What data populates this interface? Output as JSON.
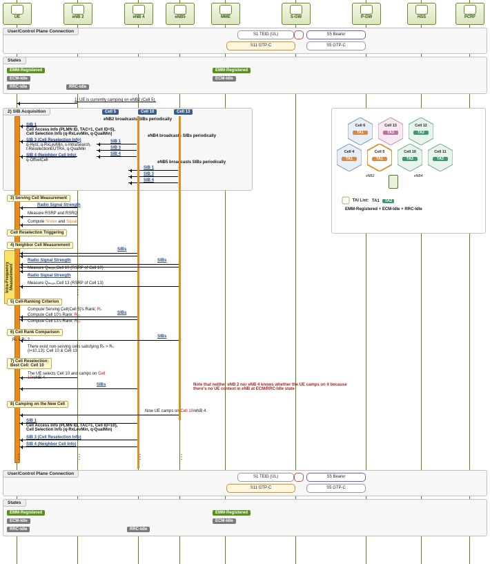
{
  "nodes": {
    "ue": "UE",
    "enb2": "eNB 2",
    "enb4": "eNB 4",
    "enb5": "eNB5",
    "mme": "MME",
    "sgw": "S-GW",
    "pgw": "P-GW",
    "hss": "HSS",
    "pcrf": "PCRF"
  },
  "conn_title": "User/Control Plane Connection",
  "conn": {
    "s1": "S1 TEID (UL)",
    "s5": "S5 Bearer",
    "s11": "S11 GTP-C",
    "s5g": "S5 GTP-C"
  },
  "states_title": "States",
  "states": {
    "emm": "EMM-Registered",
    "ecm": "ECM-Idle",
    "rrc": "RRC-Idle"
  },
  "step1": "1) UE is currently camping on eNB2 (Cell 5).",
  "sib_title": "2) SIB Acquisition",
  "cells": {
    "c5": "Cell 5",
    "c10": "Cell 10",
    "c13": "Cell 13"
  },
  "bcast": {
    "e2": "eNB2 broadcasts SIBs periodically",
    "e4": "eNB4 broadcasts SIBs periodically",
    "e5": "eNB5 broadcasts SIBs periodically"
  },
  "sibnames": {
    "s1": "SIB 1",
    "s3": "SIB 3",
    "s4": "SIB 4",
    "short3": "SIB 3 (Cell Reselection Info)",
    "short4": "SIB 4 (Neighbor Cell Info)",
    "sibs": "SIBs"
  },
  "sib1_line": "Cell Access Info (PLMN ID, TAC=1, Cell ID=5),\nCell Selection Info (q-RxLevMin, q-QualMin)",
  "sib3_line": "q-Hyst, q-RxLevMin, s-IntraSearch,\nt-ReselectionEUTRA, q-QualMin",
  "sib4_line": "q-OffsetCell",
  "step3": "3) Serving Cell Measurement",
  "rss": "Radio Signal Strength",
  "m1": "Measure RSRP and RSRQ",
  "m2": "Compute Srxlev and Squal",
  "crt": "Cell Reselection Triggering",
  "step4": "4) Neighbor Cell Measurement",
  "vstrip": "Intra-Frequency\nMeasurement",
  "q10": "Measure Qₘₑₐₛ,Cell 10 (RSRP of Cell 10)",
  "q13": "Measure Qₘₑₐₛ,Cell 13 (RSRP of Cell 13)",
  "step5": "5) Cell-Ranking Criterion",
  "rank_s": "Compute Serving Cell(Cell 5)'s Rank:",
  "rank_10": "Compute Cell 10's Rank:",
  "rank_13": "Compute Cell 13's Rank:",
  "Rs": "Rₛ",
  "R10": "R₁₀",
  "R13": "R₁₃",
  "step6": "6) Cell Rank Comparison",
  "cmp": "Rₛ > Rₛ ?",
  "cmp2": "There exist non-serving cells satisfying Rₙ > Rₛ\n(i=10,13): Cell 10 & Cell 13",
  "step7": "7) Cell Reselection:",
  "best": "Best Cell: Cell 10",
  "sel": "The UE selects Cell 10 and camps on Cell 10/eNB 4.",
  "warn": "Note that neither eNB 2 nor eNB 4 knows whether the UE camps on it because there's no UE context in eNB at ECM/RRC-Idle state",
  "step8": "8) Camping on the New Cell",
  "now": "Now UE camps on Cell 10/eNB 4.",
  "sib1_line2": "Cell Access Info (PLMN ID, TAC=1, Cell ID=10),\nCell Selection Info (q-RxLevMin, q-QualMin)",
  "tai": "TAI List:",
  "tai1": "TA1",
  "tai2": "TA2",
  "map_state": "EMM-Registered + ECM-Idle + RRC-Idle",
  "map_cells": {
    "c4": "Cell 4",
    "c5": "Cell 5",
    "c6": "Cell 6",
    "c10": "Cell 10",
    "c11": "Cell 11",
    "c12": "Cell 12",
    "c13": "Cell 13"
  },
  "map_e": {
    "e2": "eNB2",
    "e4": "eNB4"
  }
}
